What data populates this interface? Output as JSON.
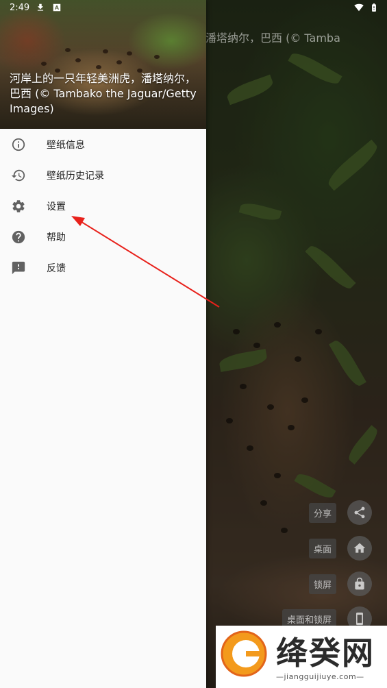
{
  "status_bar": {
    "time": "2:49",
    "left_icons": [
      "download-icon",
      "a-icon"
    ],
    "right_icons": [
      "wifi-icon",
      "battery-icon"
    ]
  },
  "wallpaper": {
    "caption_full": "河岸上的一只年轻美洲虎，潘塔纳尔，巴西 (© Tambako the Jaguar/Getty Images)",
    "caption_overflow_visible": "潘塔纳尔，巴西 (© Tamba"
  },
  "drawer": {
    "header_caption": "河岸上的一只年轻美洲虎，潘塔纳尔，巴西 (© Tambako the Jaguar/Getty Images)",
    "items": [
      {
        "icon": "info-icon",
        "label": "壁纸信息"
      },
      {
        "icon": "history-icon",
        "label": "壁纸历史记录"
      },
      {
        "icon": "gear-icon",
        "label": "设置"
      },
      {
        "icon": "help-icon",
        "label": "帮助"
      },
      {
        "icon": "feedback-icon",
        "label": "反馈"
      }
    ]
  },
  "fab_menu": [
    {
      "label": "分享",
      "icon": "share-icon"
    },
    {
      "label": "桌面",
      "icon": "home-icon"
    },
    {
      "label": "锁屏",
      "icon": "lock-icon"
    },
    {
      "label": "桌面和锁屏",
      "icon": "phone-icon"
    }
  ],
  "annotation": {
    "color": "#e8211b",
    "points_to": "设置"
  },
  "watermark": {
    "name": "绛癸网",
    "url": "jiangguijiuye.com"
  },
  "colors": {
    "drawer_bg": "#fafafa",
    "icon_gray": "#616161",
    "text": "#212121"
  }
}
